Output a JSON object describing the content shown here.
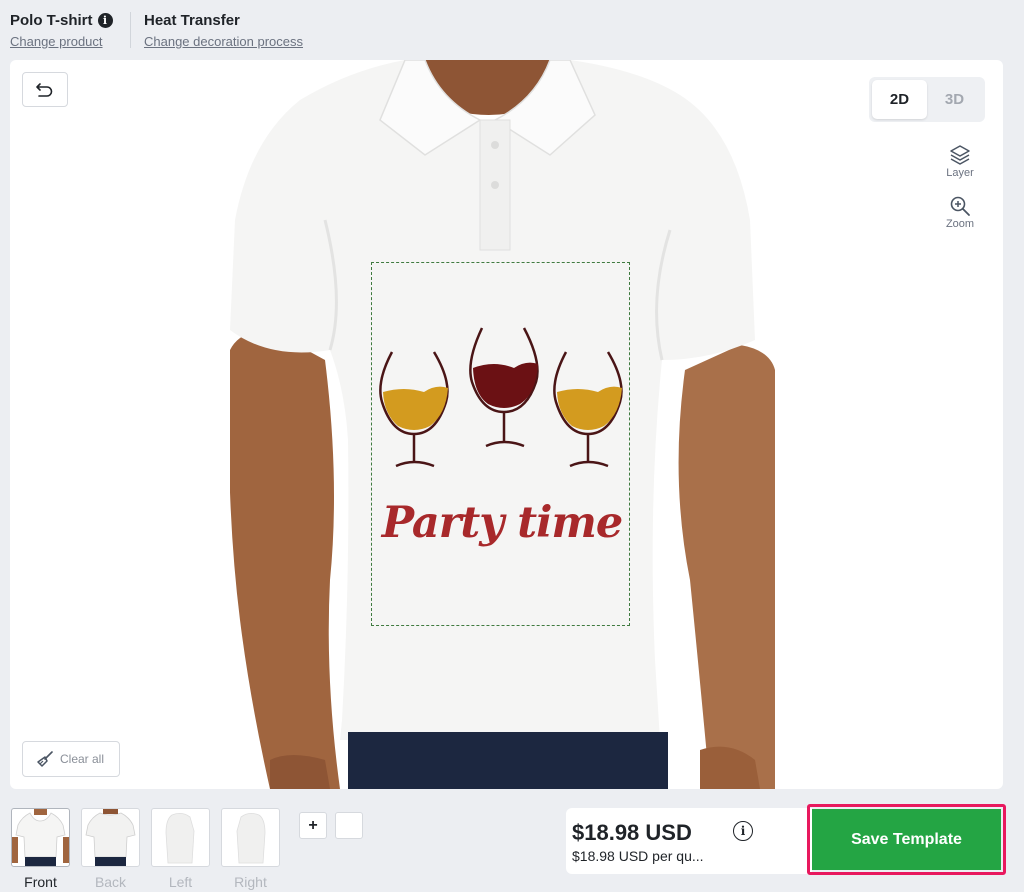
{
  "header": {
    "product_title": "Polo T-shirt",
    "change_product": "Change product",
    "process_title": "Heat Transfer",
    "change_process": "Change decoration process"
  },
  "canvas": {
    "view_2d": "2D",
    "view_3d": "3D",
    "layer_label": "Layer",
    "zoom_label": "Zoom",
    "clear_all": "Clear all",
    "design_text": "Party time"
  },
  "views": [
    {
      "label": "Front"
    },
    {
      "label": "Back"
    },
    {
      "label": "Left"
    },
    {
      "label": "Right"
    }
  ],
  "add_view": "+",
  "price": {
    "total": "$18.98 USD",
    "per_quantity": "$18.98 USD per qu..."
  },
  "save_button": "Save Template",
  "colors": {
    "accent_green": "#24a544",
    "highlight_pink": "#e8185e",
    "print_text": "#a8292b"
  }
}
